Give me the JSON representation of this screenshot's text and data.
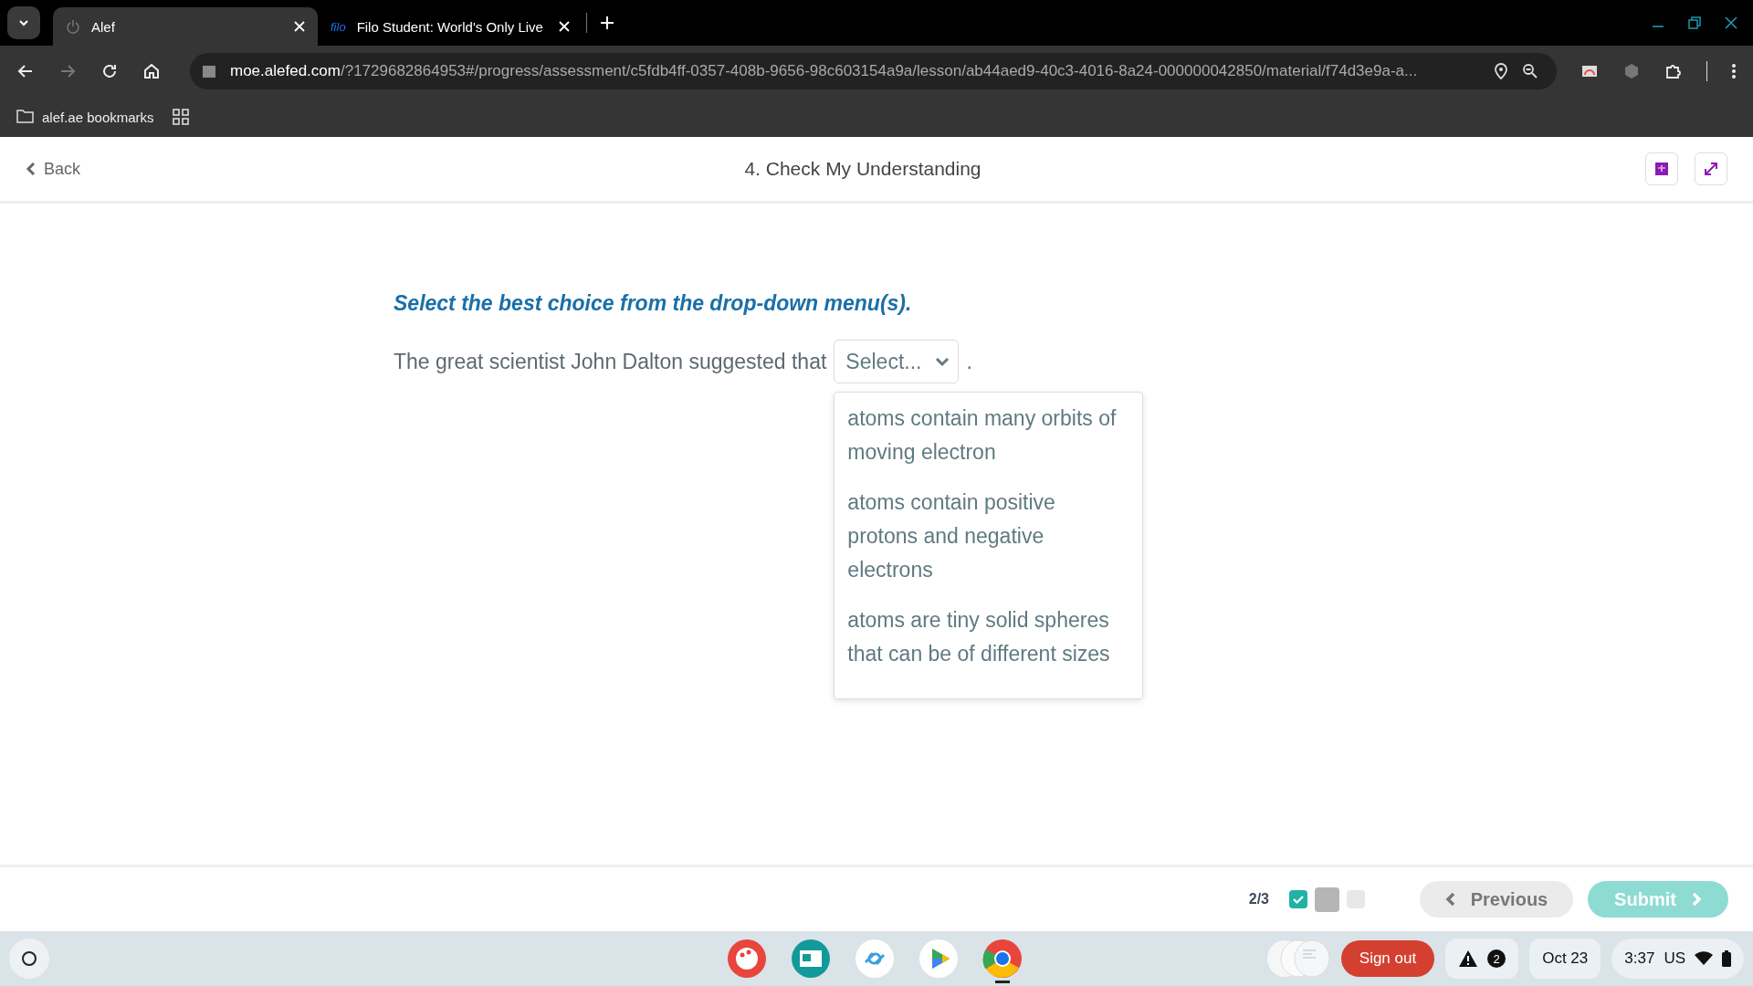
{
  "browser": {
    "tabs": [
      {
        "title": "Alef",
        "kind": "page",
        "selected": true
      },
      {
        "title": "Filo Student: World's Only Live",
        "kind": "filo",
        "favicon": "filo",
        "selected": false
      }
    ],
    "url": {
      "host": "moe.alefed.com",
      "path": "/?1729682864953#/progress/assessment/c5fdb4ff-0357-408b-9656-98c603154a9a/lesson/ab44aed9-40c3-4016-8a24-000000042850/material/f74d3e9a-a..."
    },
    "bookmarks": [
      {
        "label": "alef.ae bookmarks"
      }
    ]
  },
  "header": {
    "back": "Back",
    "title": "4. Check My Understanding"
  },
  "question": {
    "instruction": "Select the best choice from the drop-down menu(s).",
    "sentence_start": "The great scientist John Dalton suggested that",
    "sentence_end": ".",
    "dropdown": {
      "placeholder": "Select...",
      "expanded": true,
      "options": [
        "atoms contain many orbits of moving electron",
        "atoms contain positive protons and negative electrons",
        "atoms are tiny solid spheres that can be of different sizes"
      ]
    }
  },
  "footer": {
    "counter": "2/3",
    "steps": [
      {
        "checked": true,
        "selected": false
      },
      {
        "checked": false,
        "selected": true
      },
      {
        "checked": false,
        "selected": false
      }
    ],
    "previous": "Previous",
    "submit": "Submit",
    "submit_disabled": true
  },
  "taskbar": {
    "apps": [
      {
        "kind": "paint",
        "open": false
      },
      {
        "kind": "news",
        "open": false
      },
      {
        "kind": "link",
        "open": false
      },
      {
        "kind": "play",
        "open": false
      },
      {
        "kind": "chrome",
        "open": true
      }
    ],
    "sign_out": "Sign out",
    "notifications": "2",
    "date": "Oct 23",
    "time": "3:37",
    "keyboard": "US"
  }
}
